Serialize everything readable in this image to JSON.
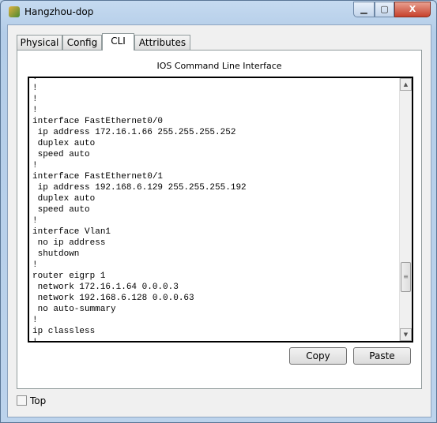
{
  "window": {
    "title": "Hangzhou-dop",
    "minimize": "▁",
    "maximize": "▢",
    "close": "X"
  },
  "tabs": [
    {
      "label": "Physical"
    },
    {
      "label": "Config"
    },
    {
      "label": "CLI",
      "active": true
    },
    {
      "label": "Attributes"
    }
  ],
  "panel": {
    "title": "IOS Command Line Interface"
  },
  "cli": {
    "lines": [
      "!",
      "!",
      "!",
      "!",
      "interface FastEthernet0/0",
      " ip address 172.16.1.66 255.255.255.252",
      " duplex auto",
      " speed auto",
      "!",
      "interface FastEthernet0/1",
      " ip address 192.168.6.129 255.255.255.192",
      " duplex auto",
      " speed auto",
      "!",
      "interface Vlan1",
      " no ip address",
      " shutdown",
      "!",
      "router eigrp 1",
      " network 172.16.1.64 0.0.0.3",
      " network 192.168.6.128 0.0.0.63",
      " no auto-summary",
      "!",
      "ip classless",
      "!"
    ]
  },
  "buttons": {
    "copy": "Copy",
    "paste": "Paste"
  },
  "top_checkbox": {
    "label": "Top",
    "checked": false
  }
}
